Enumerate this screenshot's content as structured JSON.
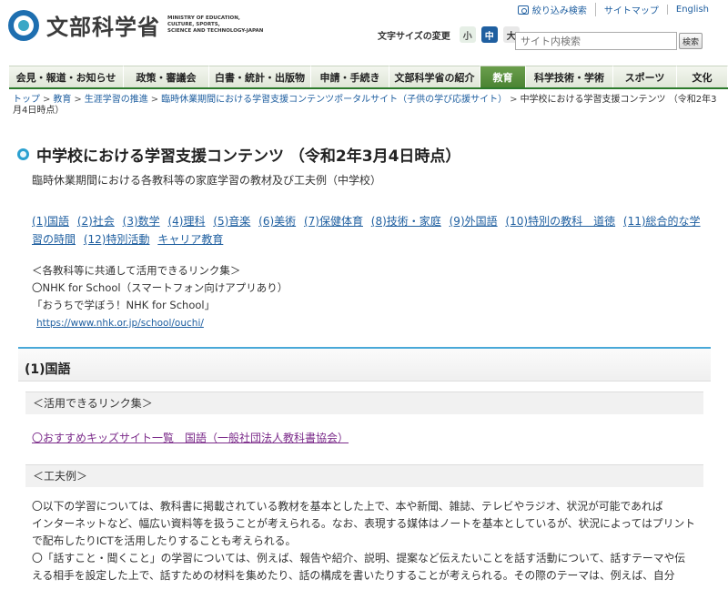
{
  "header": {
    "logo_name": "文部科学省",
    "logo_sub": "MINISTRY OF EDUCATION,\nCULTURE, SPORTS,\nSCIENCE AND TECHNOLOGY-JAPAN",
    "util_links": [
      "絞り込み検索",
      "サイトマップ",
      "English"
    ],
    "fontsize_label": "文字サイズの変更",
    "fontsize_small": "小",
    "fontsize_mid": "中",
    "fontsize_large": "大",
    "search_placeholder": "サイト内検索",
    "search_button": "検索"
  },
  "nav": {
    "items": [
      "会見・報道・お知らせ",
      "政策・審議会",
      "白書・統計・出版物",
      "申請・手続き",
      "文部科学省の紹介",
      "教育",
      "科学技術・学術",
      "スポーツ",
      "文化"
    ],
    "active_index": 5
  },
  "breadcrumb": {
    "items": [
      "トップ",
      "教育",
      "生涯学習の推進",
      "臨時休業期間における学習支援コンテンツポータルサイト（子供の学び応援サイト）"
    ],
    "current": "中学校における学習支援コンテンツ （令和2年3月4日時点）"
  },
  "main": {
    "title": "中学校における学習支援コンテンツ （令和2年3月4日時点）",
    "subtitle": "臨時休業期間における各教科等の家庭学習の教材及び工夫例（中学校）",
    "subject_links": [
      "(1)国語",
      "(2)社会",
      "(3)数学",
      "(4)理科",
      "(5)音楽",
      "(6)美術",
      "(7)保健体育",
      "(8)技術・家庭",
      "(9)外国語",
      "(10)特別の教科　道徳",
      "(11)総合的な学習の時間",
      "(12)特別活動",
      "キャリア教育"
    ],
    "common_heading": "＜各教科等に共通して活用できるリンク集＞",
    "nhk_line": "〇NHK for School（スマートフォン向けアプリあり）",
    "nhk_quote": "「おうちで学ぼう！NHK for School」",
    "nhk_url": "https://www.nhk.or.jp/school/ouchi/",
    "section_title": "(1)国語",
    "links_head": "＜活用できるリンク集＞",
    "kids_link": "〇おすすめキッズサイト一覧　国語（一般社団法人教科書協会）",
    "example_head": "＜工夫例＞",
    "body_lines": [
      "〇以下の学習については、教科書に掲載されている教材を基本とした上で、本や新聞、雑誌、テレビやラジオ、状況が可能であれば",
      "インターネットなど、幅広い資料等を扱うことが考えられる。なお、表現する媒体はノートを基本としているが、状況によってはプリント",
      "で配布したりICTを活用したりすることも考えられる。",
      "〇「話すこと・聞くこと」の学習については、例えば、報告や紹介、説明、提案など伝えたいことを話す活動について、話すテーマや伝",
      "える相手を設定した上で、話すための材料を集めたり、話の構成を書いたりすることが考えられる。その際のテーマは、例えば、自分"
    ]
  }
}
